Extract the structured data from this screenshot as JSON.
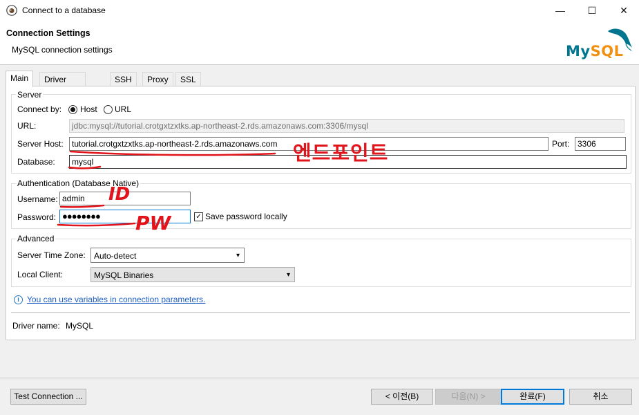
{
  "window": {
    "title": "Connect to a database",
    "minimize": "—",
    "maximize": "☐",
    "close": "✕"
  },
  "header": {
    "title": "Connection Settings",
    "subtitle": "MySQL connection settings",
    "logo_text": "MySQL"
  },
  "tabs": [
    {
      "label": "Main",
      "active": true
    },
    {
      "label": "Driver properties"
    },
    {
      "label": "SSH"
    },
    {
      "label": "Proxy"
    },
    {
      "label": "SSL"
    }
  ],
  "server": {
    "group_label": "Server",
    "connect_by_label": "Connect by:",
    "host_option": "Host",
    "url_option": "URL",
    "connect_by_selected": "Host",
    "url_label": "URL:",
    "url_value": "jdbc:mysql://tutorial.crotgxtzxtks.ap-northeast-2.rds.amazonaws.com:3306/mysql",
    "host_label": "Server Host:",
    "host_value": "tutorial.crotgxtzxtks.ap-northeast-2.rds.amazonaws.com",
    "port_label": "Port:",
    "port_value": "3306",
    "database_label": "Database:",
    "database_value": "mysql"
  },
  "auth": {
    "group_label": "Authentication (Database Native)",
    "username_label": "Username:",
    "username_value": "admin",
    "password_label": "Password:",
    "password_value": "●●●●●●●●",
    "save_password_label": "Save password locally",
    "save_password_checked": true
  },
  "advanced": {
    "group_label": "Advanced",
    "timezone_label": "Server Time Zone:",
    "timezone_value": "Auto-detect",
    "local_client_label": "Local Client:",
    "local_client_value": "MySQL Binaries"
  },
  "info_link": "You can use variables in connection parameters.",
  "driver": {
    "label": "Driver name:",
    "value": "MySQL"
  },
  "annotations": {
    "endpoint": "엔드포인트",
    "id": "ID",
    "pw": "PW"
  },
  "buttons": {
    "test": "Test Connection ...",
    "back": "< 이전(B)",
    "next": "다음(N) >",
    "finish": "완료(F)",
    "cancel": "취소"
  },
  "colors": {
    "accent": "#0078d7",
    "link": "#1f5fc2",
    "annotation": "#e2141b",
    "mysql_blue": "#00758f",
    "mysql_orange": "#f29111"
  }
}
